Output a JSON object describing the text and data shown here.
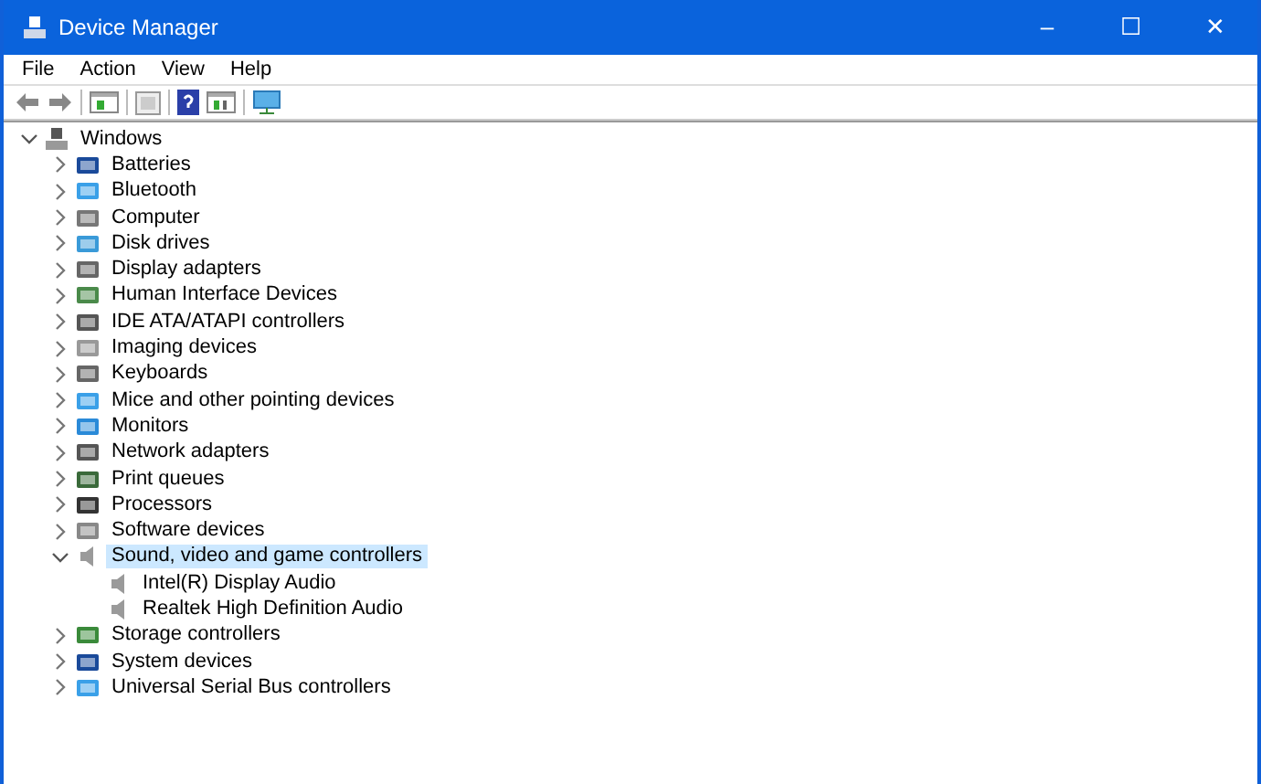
{
  "window": {
    "title": "Device Manager",
    "controls": [
      "–",
      "☐",
      "✕"
    ]
  },
  "menu": [
    "File",
    "Action",
    "View",
    "Help"
  ],
  "tree": {
    "label": "Windows",
    "expanded": true,
    "selected": false,
    "children": [
      {
        "label": "Batteries",
        "expanded": false,
        "selected": false
      },
      {
        "label": "Bluetooth",
        "expanded": false,
        "selected": false
      },
      {
        "label": "Computer",
        "expanded": false,
        "selected": false
      },
      {
        "label": "Disk drives",
        "expanded": false,
        "selected": false
      },
      {
        "label": "Display adapters",
        "expanded": false,
        "selected": false
      },
      {
        "label": "Human Interface Devices",
        "expanded": false,
        "selected": false
      },
      {
        "label": "IDE ATA/ATAPI controllers",
        "expanded": false,
        "selected": false
      },
      {
        "label": "Imaging devices",
        "expanded": false,
        "selected": false
      },
      {
        "label": "Keyboards",
        "expanded": false,
        "selected": false
      },
      {
        "label": "Mice and other pointing devices",
        "expanded": false,
        "selected": false
      },
      {
        "label": "Monitors",
        "expanded": false,
        "selected": false
      },
      {
        "label": "Network adapters",
        "expanded": false,
        "selected": false
      },
      {
        "label": "Print queues",
        "expanded": false,
        "selected": false
      },
      {
        "label": "Processors",
        "expanded": false,
        "selected": false
      },
      {
        "label": "Software devices",
        "expanded": false,
        "selected": false
      },
      {
        "label": "Sound, video and game controllers",
        "expanded": true,
        "selected": true,
        "children": [
          {
            "label": "Intel(R) Display Audio",
            "selected": false
          },
          {
            "label": "Realtek High Definition Audio",
            "selected": false
          }
        ]
      },
      {
        "label": "Storage controllers",
        "expanded": false,
        "selected": false
      },
      {
        "label": "System devices",
        "expanded": false,
        "selected": false
      },
      {
        "label": "Universal Serial Bus controllers",
        "expanded": false,
        "selected": false
      }
    ]
  }
}
